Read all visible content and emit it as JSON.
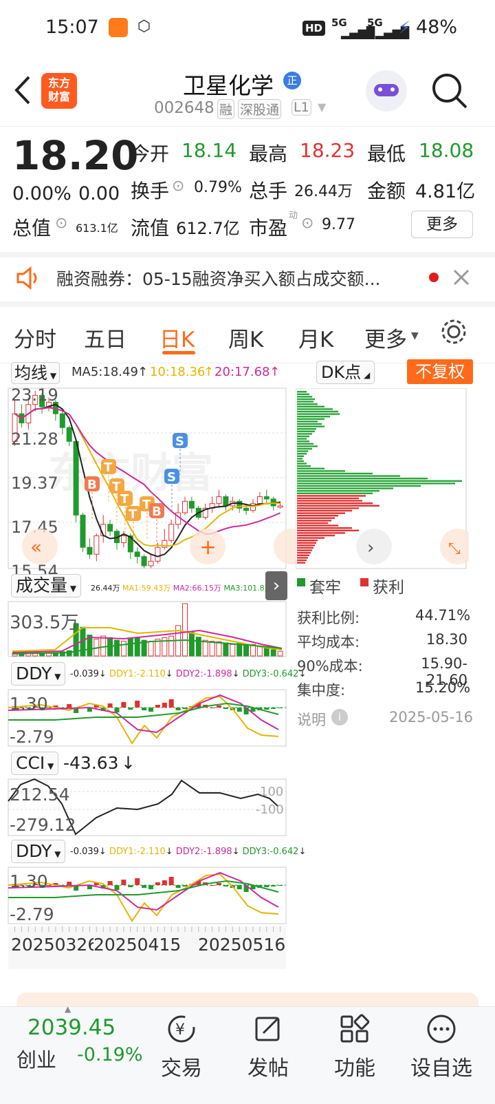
{
  "status": {
    "time": "15:07",
    "hd": "HD",
    "net1": "5G",
    "net2": "5G",
    "battery": "48%"
  },
  "header": {
    "logo_line1": "东方",
    "logo_line2": "财富",
    "title": "卫星化学",
    "title_badge": "正",
    "code": "002648",
    "tag_rong": "融",
    "tag_sgt": "深股通",
    "tag_level": "L1"
  },
  "quote": {
    "price": "18.20",
    "change_pct": "0.00%",
    "change": "0.00",
    "open_label": "今开",
    "open": "18.14",
    "high_label": "最高",
    "high": "18.23",
    "low_label": "最低",
    "low": "18.08",
    "turnover_rate_label": "换手",
    "turnover_rate": "0.79%",
    "volume_label": "总手",
    "volume": "26.44万",
    "amount_label": "金额",
    "amount": "4.81亿",
    "mcap_label": "总值",
    "mcap": "613.1亿",
    "float_label": "流值",
    "float": "612.7亿",
    "pe_label": "市盈",
    "pe_sup": "动",
    "pe": "9.77",
    "more_button": "更多"
  },
  "notice": {
    "text": "融资融券：05-15融资净买入额占成交额..."
  },
  "tabs": {
    "items": [
      "分时",
      "五日",
      "日K",
      "周K",
      "月K",
      "更多"
    ],
    "active": "日K"
  },
  "chart_toolbar": {
    "ma_selector": "均线",
    "ma5": "MA5:18.49",
    "ma10": "10:18.36",
    "ma20": "20:17.68",
    "dk_selector": "DK点",
    "adjust_button": "不复权"
  },
  "chart_data": [
    {
      "type": "candlestick",
      "title": "日K",
      "ylim": [
        15.54,
        23.19
      ],
      "y_ticks": [
        "23.19",
        "21.28",
        "19.37",
        "17.45",
        "15.54"
      ],
      "x_tick_labels": [
        "20250326",
        "20250415",
        "20250516"
      ],
      "series": [
        {
          "name": "MA5",
          "last": 18.49
        },
        {
          "name": "MA10",
          "last": 18.36
        },
        {
          "name": "MA20",
          "last": 17.68
        }
      ],
      "markers": [
        "B",
        "T",
        "T",
        "T",
        "T",
        "T",
        "B",
        "S",
        "S"
      ]
    },
    {
      "type": "bar",
      "title": "成交量",
      "header": [
        "26.44万",
        "MA1:59.43万",
        "MA2:66.15万",
        "MA3:101.8万"
      ],
      "y_ticks": [
        "303.5万"
      ]
    },
    {
      "type": "line",
      "title": "DDY",
      "header": [
        "-0.039",
        "DDY1:-2.110",
        "DDY2:-1.898",
        "DDY3:-0.642"
      ],
      "y_ticks": [
        "1.30",
        "-2.79"
      ]
    },
    {
      "type": "line",
      "title": "CCI",
      "header": [
        "-43.63"
      ],
      "y_ticks": [
        "212.54",
        "-279.12"
      ],
      "reference_labels": [
        "100",
        "-100"
      ]
    },
    {
      "type": "line",
      "title": "DDY",
      "header": [
        "-0.039",
        "DDY1:-2.110",
        "DDY2:-1.898",
        "DDY3:-0.642"
      ],
      "y_ticks": [
        "1.30",
        "-2.79"
      ]
    },
    {
      "type": "bar",
      "title": "DK点",
      "legend": [
        "套牢",
        "获利"
      ],
      "stats": [
        {
          "label": "获利比例:",
          "value": "44.71%"
        },
        {
          "label": "平均成本:",
          "value": "18.30"
        },
        {
          "label": "90%成本:",
          "value": "15.90-21.60"
        },
        {
          "label": "集中度:",
          "value": "15.20%"
        }
      ],
      "note_label": "说明",
      "date": "2025-05-16"
    }
  ],
  "bottom_nav": {
    "index_value": "2039.45",
    "index_name": "创业",
    "index_change": "-0.19%",
    "items": [
      "交易",
      "发帖",
      "功能",
      "设自选"
    ]
  },
  "colors": {
    "accent": "#ff6a1a",
    "up": "#e03131",
    "down": "#1f9a2c"
  }
}
